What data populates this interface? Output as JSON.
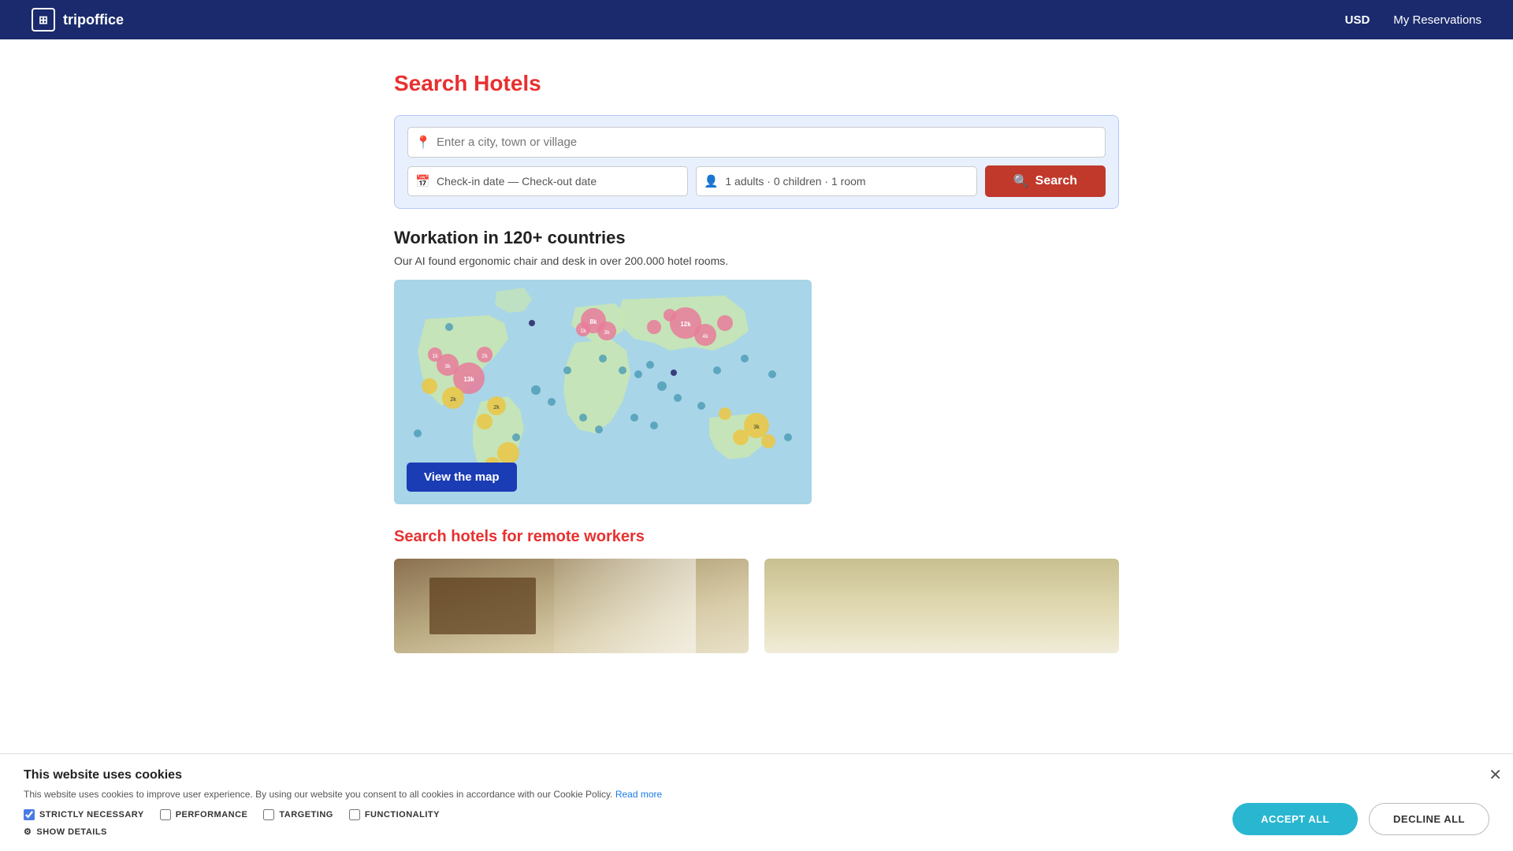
{
  "navbar": {
    "brand": "tripoffice",
    "currency": "USD",
    "reservations": "My Reservations"
  },
  "search": {
    "title_plain": "Search ",
    "title_colored": "Hotels",
    "location_placeholder": "Enter a city, town or village",
    "date_placeholder": "Check-in date — Check-out date",
    "guests_value": "1 adults · 0 children · 1 room",
    "search_button": "Search"
  },
  "workation": {
    "title": "Workation in 120+ countries",
    "description": "Our AI found ergonomic chair and desk in over 200.000 hotel rooms.",
    "view_map_button": "View the map"
  },
  "remote": {
    "title_plain": "Search hotels for ",
    "title_colored": "remote workers"
  },
  "cookie": {
    "title": "This website uses cookies",
    "description": "This website uses cookies to improve user experience. By using our website you consent to all cookies in accordance with our Cookie Policy.",
    "read_more": "Read more",
    "options": [
      {
        "label": "STRICTLY NECESSARY",
        "checked": true
      },
      {
        "label": "PERFORMANCE",
        "checked": false
      },
      {
        "label": "TARGETING",
        "checked": false
      },
      {
        "label": "FUNCTIONALITY",
        "checked": false
      }
    ],
    "show_details": "SHOW DETAILS",
    "accept_button": "ACCEPT ALL",
    "decline_button": "DECLINE ALL"
  }
}
